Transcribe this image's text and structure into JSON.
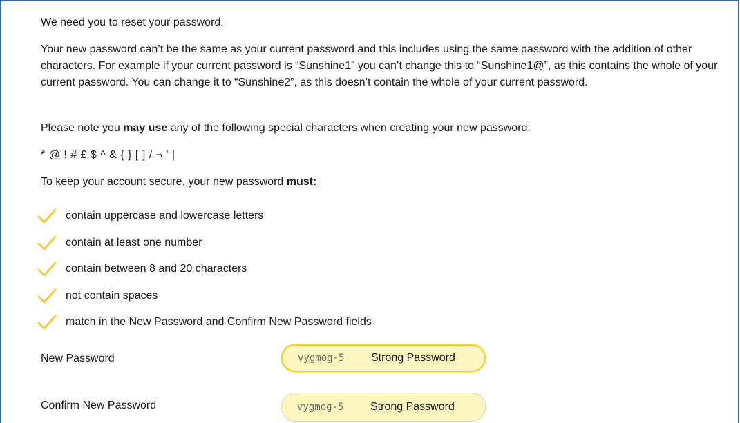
{
  "intro": "We need you to reset your password.",
  "rules_paragraph": "Your new password can’t be the same as your current password and this includes using the same password with the addition of other characters. For example if your current password is “Sunshine1” you can’t change this to “Sunshine1@”, as this contains the whole of your current password. You can change it to “Sunshine2”, as this doesn’t contain the whole of your current password.",
  "special_note": {
    "before": "Please note you ",
    "emphasis": "may use",
    "after": " any of the following special characters when creating your new password:"
  },
  "special_chars": "* @ ! # £ $ ^ & { } [ ] / ¬ ' |",
  "secure_note": {
    "before": "To keep your account secure, your new password ",
    "emphasis": "must:"
  },
  "requirements": [
    {
      "text": "contain uppercase and lowercase letters",
      "icon": "check-icon"
    },
    {
      "text": "contain at least one number",
      "icon": "check-icon"
    },
    {
      "text": "contain between 8 and 20 characters",
      "icon": "check-icon"
    },
    {
      "text": "not contain spaces",
      "icon": "check-icon"
    },
    {
      "text": "match in the New Password and Confirm New Password fields",
      "icon": "check-icon"
    }
  ],
  "new_password": {
    "label": "New Password",
    "value": "vygmog-5",
    "strength": "Strong Password"
  },
  "confirm_password": {
    "label": "Confirm New Password",
    "value": "vygmog-5",
    "strength": "Strong Password"
  },
  "colors": {
    "check": "#f5c842",
    "frame": "#2f6db5",
    "field_bg": "#fbf6bd",
    "field_focus_border": "#f2cf3b"
  }
}
